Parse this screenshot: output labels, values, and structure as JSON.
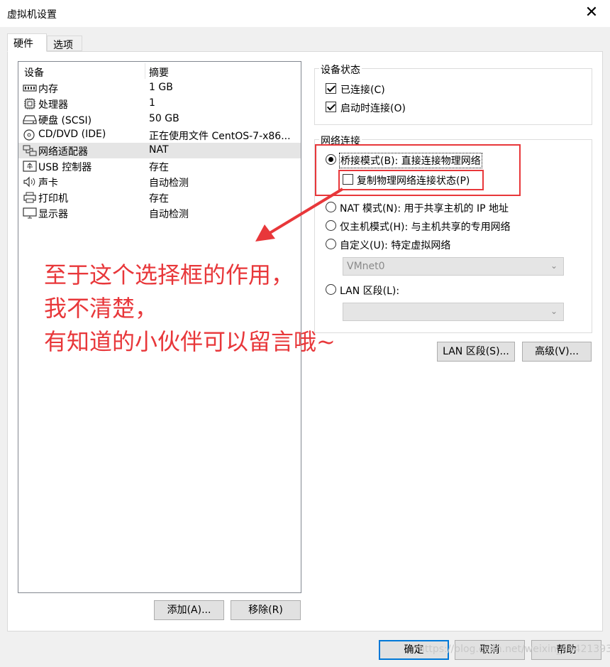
{
  "window": {
    "title": "虚拟机设置",
    "close_glyph": "✕"
  },
  "tabs": [
    {
      "label": "硬件"
    },
    {
      "label": "选项"
    }
  ],
  "device_list": {
    "headers": {
      "device": "设备",
      "summary": "摘要"
    },
    "rows": [
      {
        "name": "内存",
        "summary": "1 GB",
        "icon": "memory-icon"
      },
      {
        "name": "处理器",
        "summary": "1",
        "icon": "processor-icon"
      },
      {
        "name": "硬盘 (SCSI)",
        "summary": "50 GB",
        "icon": "harddisk-icon"
      },
      {
        "name": "CD/DVD (IDE)",
        "summary": "正在使用文件 CentOS-7-x86...",
        "icon": "cd-icon"
      },
      {
        "name": "网络适配器",
        "summary": "NAT",
        "icon": "network-adapter-icon"
      },
      {
        "name": "USB 控制器",
        "summary": "存在",
        "icon": "usb-icon"
      },
      {
        "name": "声卡",
        "summary": "自动检测",
        "icon": "speaker-icon"
      },
      {
        "name": "打印机",
        "summary": "存在",
        "icon": "printer-icon"
      },
      {
        "name": "显示器",
        "summary": "自动检测",
        "icon": "monitor-icon"
      }
    ],
    "selected_row": "网络适配器",
    "add_label": "添加(A)...",
    "remove_label": "移除(R)"
  },
  "device_status": {
    "title": "设备状态",
    "connected": {
      "label": "已连接(C)",
      "checked": true
    },
    "connect_at_power_on": {
      "label": "启动时连接(O)",
      "checked": true
    }
  },
  "network_connection": {
    "title": "网络连接",
    "bridged": {
      "label": "桥接模式(B): 直接连接物理网络",
      "selected": true
    },
    "replicate": {
      "label": "复制物理网络连接状态(P)",
      "checked": false
    },
    "nat": {
      "label": "NAT 模式(N): 用于共享主机的 IP 地址",
      "selected": false
    },
    "host_only": {
      "label": "仅主机模式(H): 与主机共享的专用网络",
      "selected": false
    },
    "custom": {
      "label": "自定义(U): 特定虚拟网络",
      "selected": false
    },
    "custom_select_value": "VMnet0",
    "lan_segment": {
      "label": "LAN 区段(L):",
      "selected": false
    },
    "lan_select_value": ""
  },
  "buttons": {
    "lan_segments": "LAN 区段(S)...",
    "advanced": "高级(V)...",
    "ok": "确定",
    "cancel": "取消",
    "help": "帮助"
  },
  "annotation": {
    "line1": "至于这个选择框的作用，",
    "line2": "我不清楚，",
    "line3": "有知道的小伙伴可以留言哦~"
  },
  "watermark": "https://blog.csdn.net/weixin_44421393",
  "colors": {
    "annotation_red": "#e8373a",
    "focus_blue": "#0078d7"
  }
}
